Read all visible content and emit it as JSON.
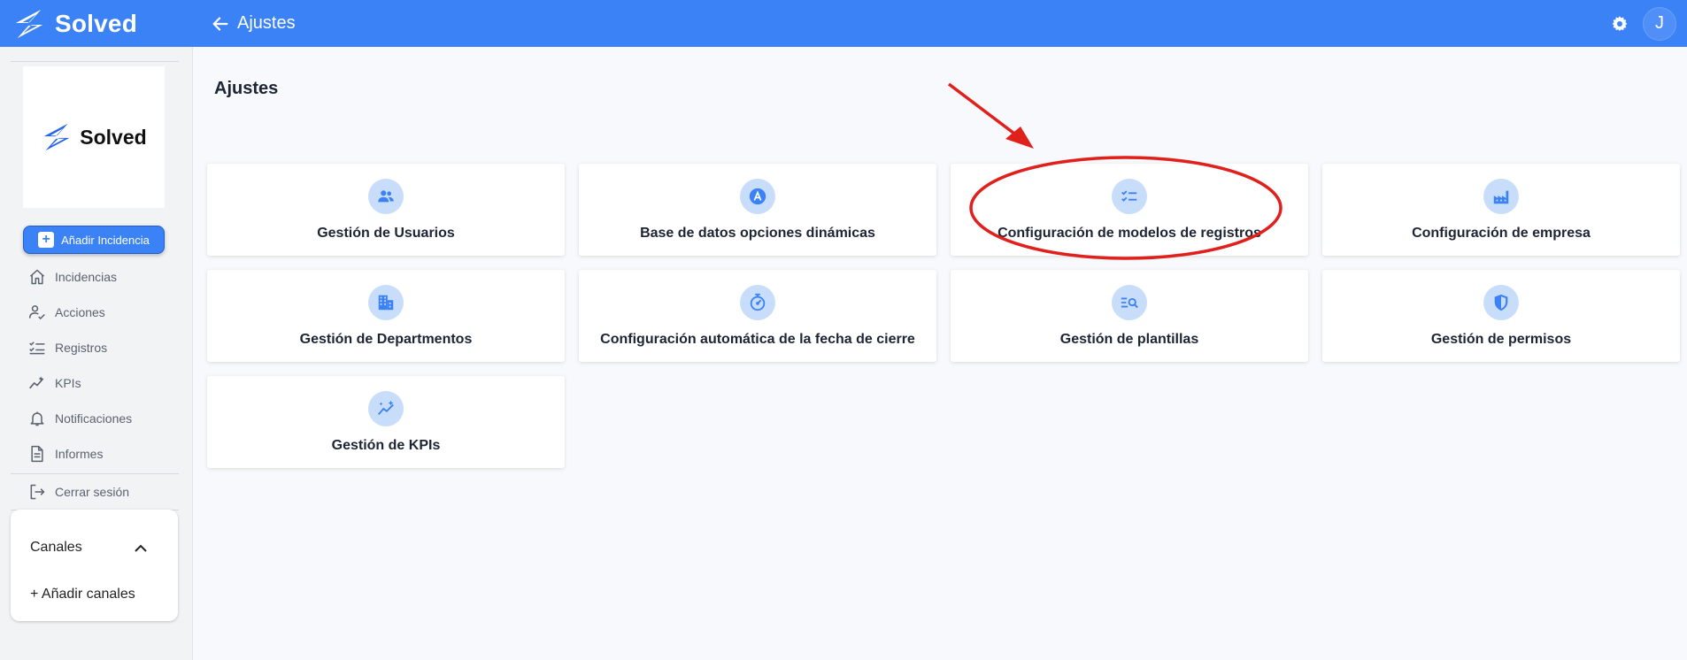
{
  "topbar": {
    "brand": "Solved",
    "title": "Ajustes",
    "avatar_initial": "J"
  },
  "sidebar": {
    "logo_text": "Solved",
    "add_button_label": "Añadir Incidencia",
    "items": [
      {
        "label": "Incidencias",
        "icon": "home-icon"
      },
      {
        "label": "Acciones",
        "icon": "user-check-icon"
      },
      {
        "label": "Registros",
        "icon": "checklist-icon"
      },
      {
        "label": "KPIs",
        "icon": "trending-icon"
      },
      {
        "label": "Notificaciones",
        "icon": "bell-icon"
      },
      {
        "label": "Informes",
        "icon": "document-icon"
      }
    ],
    "logout_label": "Cerrar sesión",
    "channels": {
      "title": "Canales",
      "add_label": "+ Añadir canales"
    }
  },
  "main": {
    "title": "Ajustes",
    "cards": [
      {
        "label": "Gestión de Usuarios",
        "icon": "users-icon"
      },
      {
        "label": "Base de datos opciones dinámicas",
        "icon": "letter-a-icon"
      },
      {
        "label": "Configuración de modelos de registros",
        "icon": "checklist-icon"
      },
      {
        "label": "Configuración de empresa",
        "icon": "factory-icon"
      },
      {
        "label": "Gestión de Departmentos",
        "icon": "building-icon"
      },
      {
        "label": "Configuración automática de la fecha de cierre",
        "icon": "timer-icon"
      },
      {
        "label": "Gestión de plantillas",
        "icon": "list-search-icon"
      },
      {
        "label": "Gestión de permisos",
        "icon": "shield-icon"
      },
      {
        "label": "Gestión de KPIs",
        "icon": "sparkle-chart-icon"
      }
    ]
  },
  "colors": {
    "primary": "#3b82f6",
    "icon_bg": "#c8ddf9",
    "annotation": "#e0201b"
  }
}
